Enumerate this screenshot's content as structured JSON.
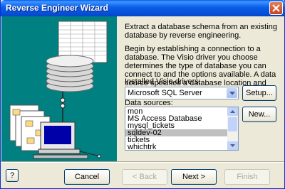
{
  "window": {
    "title": "Reverse Engineer Wizard"
  },
  "intro": {
    "p1": "Extract a database schema from an existing database by reverse engineering.",
    "p2": "Begin by establishing a connection to a database. The Visio driver you choose determines the type of database you can connect to and the options available. A data source specifies a database location and connection information."
  },
  "drivers": {
    "label": "Installed Visio drivers:",
    "selected": "Microsoft SQL Server"
  },
  "sources": {
    "label": "Data sources:",
    "items": [
      "mon",
      "MS Access Database",
      "mysql_tickets",
      "sqldev-02",
      "tickets",
      "whichtrk"
    ],
    "selected": "sqldev-02"
  },
  "buttons": {
    "setup": "Setup...",
    "new": "New...",
    "help": "?",
    "cancel": "Cancel",
    "back": "< Back",
    "next": "Next >",
    "finish": "Finish"
  }
}
